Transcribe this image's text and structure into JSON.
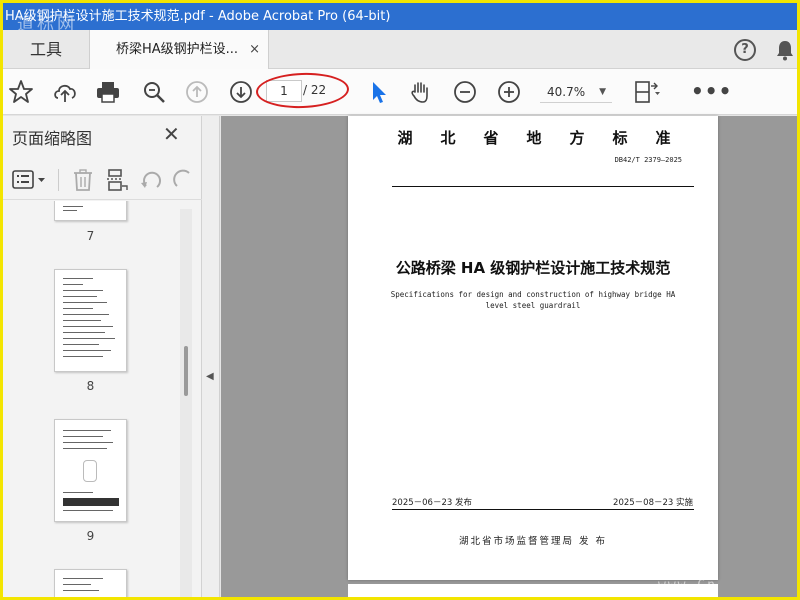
{
  "window": {
    "title": "HA级钢护栏设计施工技术规范.pdf - Adobe Acrobat Pro (64-bit)"
  },
  "watermark": {
    "top_left": "道标网",
    "bottom_right": "www.Cn"
  },
  "tabs": {
    "tools_label": "工具",
    "document_label": "桥梁HA级钢护栏设...",
    "close_glyph": "×"
  },
  "toolbar": {
    "page_current": "1",
    "page_total": "/ 22",
    "zoom": "40.7%"
  },
  "thumbnail_panel": {
    "title": "页面缩略图",
    "close_glyph": "✕",
    "pages": [
      {
        "label": "7"
      },
      {
        "label": "8"
      },
      {
        "label": "9"
      },
      {
        "label": ""
      }
    ]
  },
  "document": {
    "province": "湖北省地方标准",
    "code": "DB42/T 2379—2025",
    "title": "公路桥梁 HA 级钢护栏设计施工技术规范",
    "english_title": "Specifications for design and construction of highway bridge HA level steel guardrail",
    "release_date": "2025－06－23 发布",
    "implement_date": "2025－08－23 实施",
    "issuer": "湖北省市场监督管理局   发 布"
  },
  "colors": {
    "titlebar": "#2c6fd0",
    "frame": "#f3e500",
    "select_arrow": "#1a73e8",
    "annotation": "#d62020"
  }
}
